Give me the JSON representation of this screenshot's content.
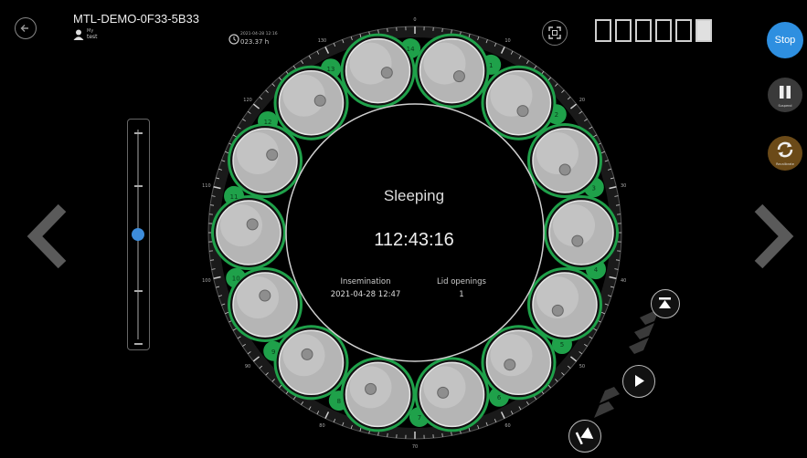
{
  "header": {
    "device_id": "MTL-DEMO-0F33-5B33",
    "user_role": "My",
    "user_name": "test",
    "start_datetime": "2021-04-28 12:16",
    "elapsed": "023.37 h"
  },
  "slots": {
    "count": 6,
    "filled_index": 5
  },
  "buttons": {
    "stop_label": "Stop",
    "suspend_label": "Suspend",
    "recalibrate_label": "Recalibrate"
  },
  "dish": {
    "status": "Sleeping",
    "timer": "112:43:16",
    "insemination_label": "Insemination",
    "insemination_value": "2021-04-28 12:47",
    "lid_openings_label": "Lid openings",
    "lid_openings_value": "1",
    "well_numbers": [
      "1",
      "2",
      "3",
      "4",
      "5",
      "6",
      "7",
      "8",
      "9",
      "10",
      "11",
      "12",
      "13",
      "14"
    ],
    "scale_labels": [
      "0",
      "10",
      "20",
      "30",
      "40",
      "50",
      "60",
      "70",
      "80",
      "90",
      "100",
      "110",
      "120",
      "130"
    ]
  },
  "slider": {
    "level": 0.5
  },
  "colors": {
    "accent_green": "#1fa14a",
    "stop_blue": "#2e8fe0",
    "recal_brown": "#6b4a18",
    "slider_knob": "#3d8cda"
  },
  "icons": [
    "back-arrow-icon",
    "user-icon",
    "clock-icon",
    "expand-icon",
    "pause-icon",
    "refresh-icon",
    "chevron-left-icon",
    "chevron-right-icon",
    "skip-start-icon",
    "play-icon",
    "skip-end-icon"
  ]
}
